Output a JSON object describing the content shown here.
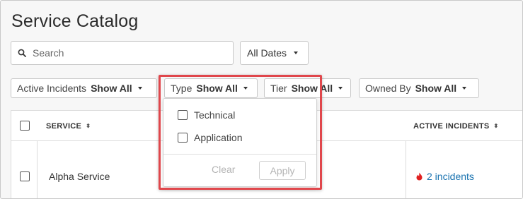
{
  "page": {
    "title": "Service Catalog"
  },
  "search": {
    "placeholder": "Search"
  },
  "date_filter": {
    "label": "All Dates"
  },
  "filters": [
    {
      "label": "Active Incidents",
      "value": "Show All"
    },
    {
      "label": "Type",
      "value": "Show All"
    },
    {
      "label": "Tier",
      "value": "Show All"
    },
    {
      "label": "Owned By",
      "value": "Show All"
    }
  ],
  "type_dropdown": {
    "options": [
      "Technical",
      "Application"
    ],
    "clear_label": "Clear",
    "apply_label": "Apply"
  },
  "table": {
    "columns": [
      "SERVICE",
      "ACTIVE INCIDENTS"
    ],
    "sort_glyph": "⬍",
    "rows": [
      {
        "service": "Alpha Service",
        "incidents": "2 incidents"
      }
    ]
  },
  "colors": {
    "highlight": "#e0474c",
    "link": "#1a73b0",
    "incident_icon": "#e02020"
  },
  "icons": {
    "search": "search-icon",
    "caret": "chevron-down-icon",
    "incident": "flame-icon"
  }
}
